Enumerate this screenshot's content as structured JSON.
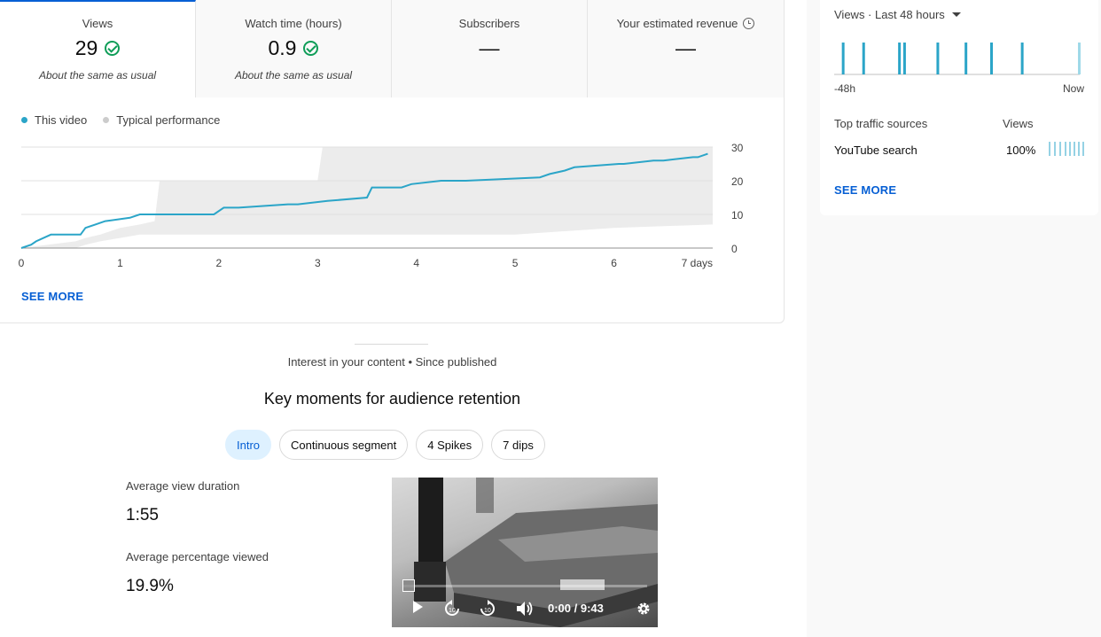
{
  "tabs": [
    {
      "title": "Views",
      "value": "29",
      "note": "About the same as usual"
    },
    {
      "title": "Watch time (hours)",
      "value": "0.9",
      "note": "About the same as usual"
    },
    {
      "title": "Subscribers",
      "value": "—",
      "note": ""
    },
    {
      "title": "Your estimated revenue",
      "value": "—",
      "note": ""
    }
  ],
  "legend": {
    "this_video": "This video",
    "typical": "Typical performance"
  },
  "colors": {
    "accent": "#065fd4",
    "series": "#2ba5c8",
    "typical_band": "#ececec",
    "check": "#0f9d58",
    "chip_active_bg": "#def1ff"
  },
  "chart_data": {
    "type": "line",
    "x_ticks": [
      "0",
      "1",
      "2",
      "3",
      "4",
      "5",
      "6",
      "7 days"
    ],
    "y_ticks": [
      "30",
      "20",
      "10",
      "0"
    ],
    "ylim": [
      0,
      30
    ],
    "xlim": [
      0,
      7
    ],
    "series": [
      {
        "name": "This video",
        "x": [
          0,
          0.1,
          0.15,
          0.3,
          0.6,
          0.65,
          0.75,
          0.85,
          1.1,
          1.2,
          1.95,
          2.05,
          2.2,
          2.7,
          2.8,
          3.1,
          3.5,
          3.55,
          3.85,
          3.95,
          4.25,
          4.5,
          5.25,
          5.35,
          5.5,
          5.6,
          6.05,
          6.1,
          6.4,
          6.5,
          6.8,
          6.85,
          6.95
        ],
        "y": [
          0,
          1,
          2,
          4,
          4,
          6,
          7,
          8,
          9,
          10,
          10,
          12,
          12,
          13,
          13,
          14,
          15,
          18,
          18,
          19,
          20,
          20,
          21,
          22,
          23,
          24,
          25,
          25,
          26,
          26,
          27,
          27,
          28
        ]
      },
      {
        "name": "Typical performance",
        "x": [
          0,
          0.55,
          0.65,
          0.8,
          1.0,
          1.2,
          1.35,
          1.4,
          1.6,
          2.0,
          3.0,
          3.05,
          4.0,
          5.0,
          6.0,
          7.0
        ],
        "y_low": [
          0,
          0,
          1,
          2,
          3,
          4,
          4,
          4,
          4,
          4,
          4,
          4,
          4,
          4,
          6,
          7
        ],
        "y_high": [
          0,
          2,
          3,
          4,
          6,
          7,
          8,
          20,
          20,
          20,
          20,
          30,
          30,
          30,
          30,
          30
        ]
      }
    ]
  },
  "see_more": "SEE MORE",
  "realtime": {
    "dropdown_label": "Views · Last 48 hours",
    "axis_left": "-48h",
    "axis_right": "Now",
    "bars_hours_ago": [
      46.5,
      42.5,
      35.5,
      34.5,
      28,
      22.5,
      17.5,
      11.5
    ],
    "header_sources": "Top traffic sources",
    "header_views": "Views",
    "sources": [
      {
        "name": "YouTube search",
        "percent": "100%"
      }
    ],
    "see_more": "SEE MORE"
  },
  "lower": {
    "subtitle": "Interest in your content • Since published",
    "heading": "Key moments for audience retention",
    "chips": [
      "Intro",
      "Continuous segment",
      "4 Spikes",
      "7 dips"
    ],
    "avg_duration_label": "Average view duration",
    "avg_duration_value": "1:55",
    "avg_percent_label": "Average percentage viewed",
    "avg_percent_value": "19.9%",
    "player_time": "0:00 / 9:43"
  }
}
